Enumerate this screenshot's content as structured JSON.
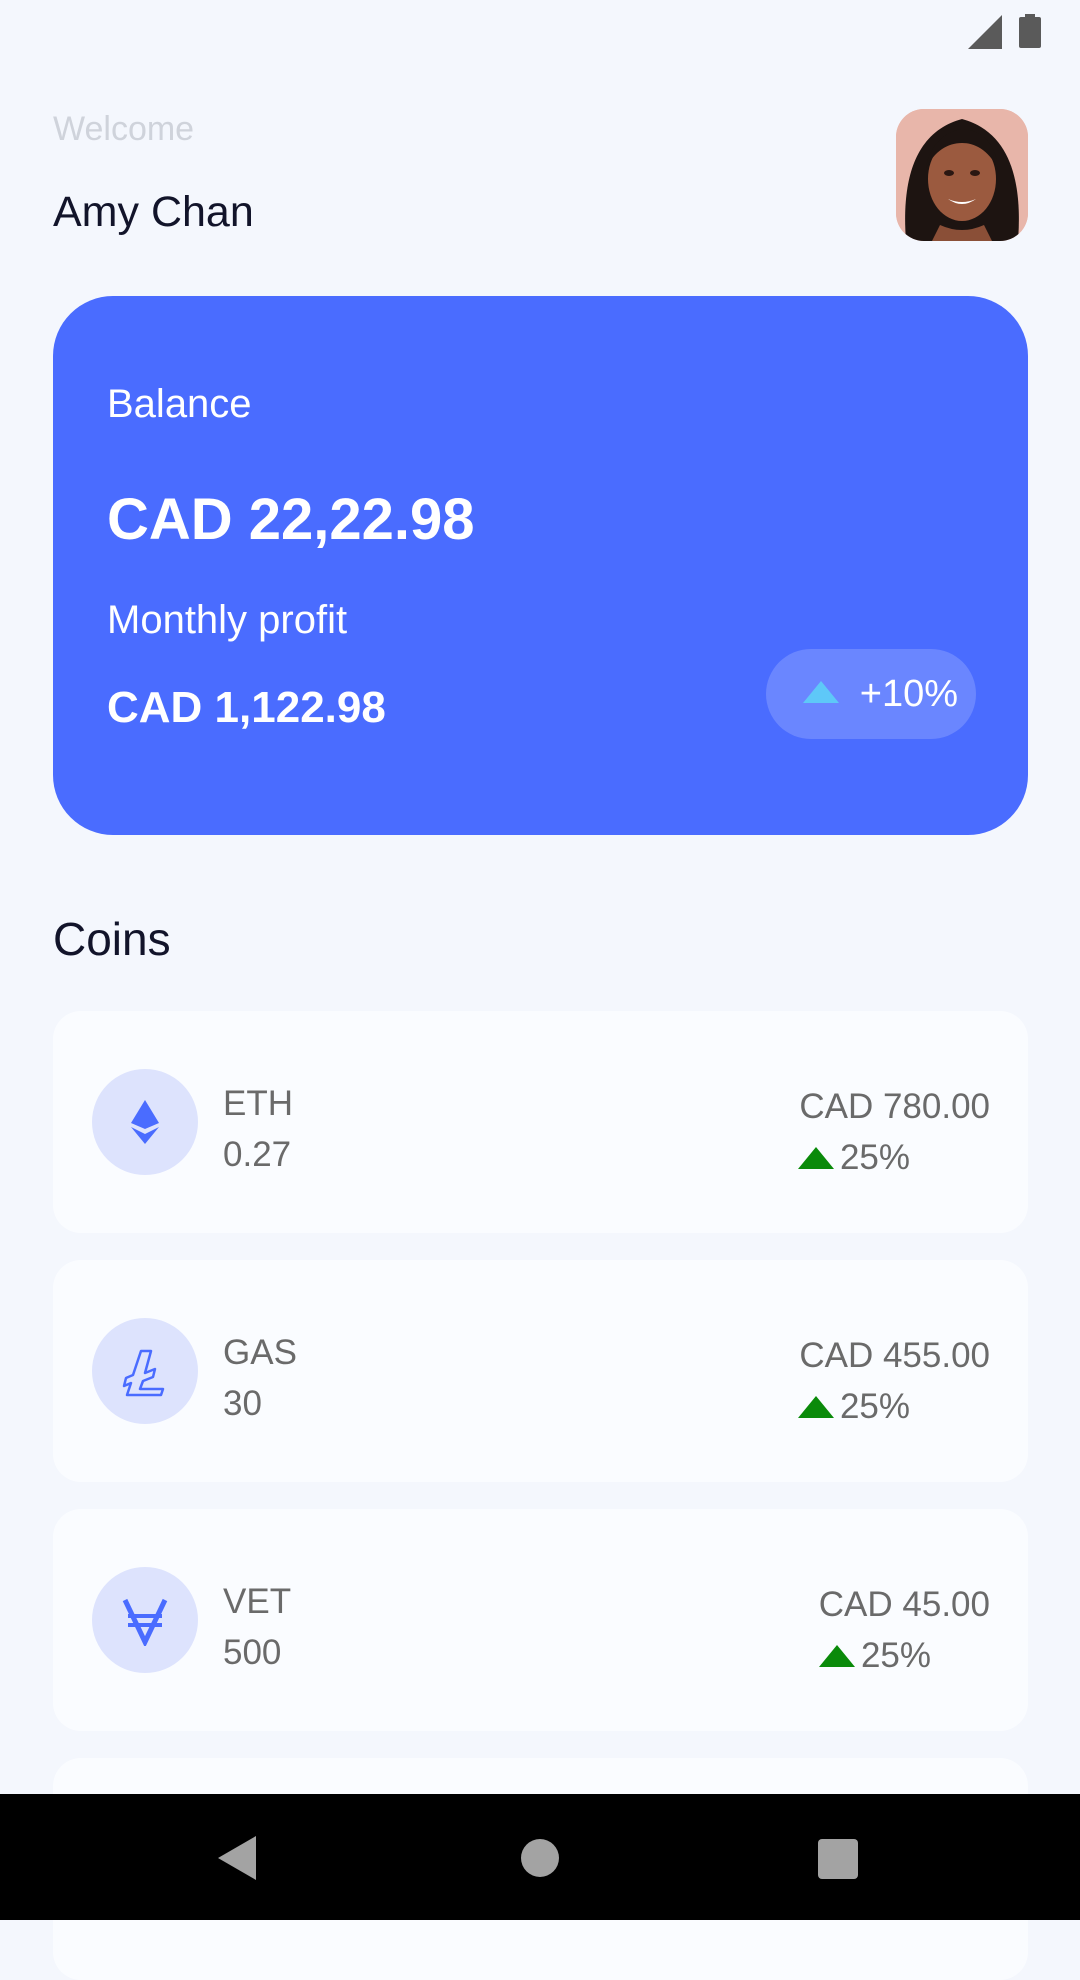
{
  "status_bar": {
    "icons": [
      "signal-icon",
      "battery-icon"
    ],
    "icon_color": "#5a5a5a"
  },
  "header": {
    "welcome": "Welcome",
    "user_name": "Amy Chan",
    "avatar_icon": "avatar-photo"
  },
  "balance_card": {
    "background_color": "#4a6cff",
    "balance_label": "Balance",
    "balance_amount": "CAD 22,22.98",
    "profit_label": "Monthly profit",
    "profit_amount": "CAD 1,122.98",
    "profit_change": "+10%",
    "profit_change_icon": "arrow-up-icon",
    "profit_change_color": "#5ec8f8"
  },
  "coins": {
    "title": "Coins",
    "positive_color": "#0a8a0a",
    "items": [
      {
        "icon": "ethereum-icon",
        "symbol": "ETH",
        "amount": "0.27",
        "value": "CAD 780.00",
        "change": "25%"
      },
      {
        "icon": "litecoin-icon",
        "symbol": "GAS",
        "amount": "30",
        "value": "CAD 455.00",
        "change": "25%"
      },
      {
        "icon": "vechain-icon",
        "symbol": "VET",
        "amount": "500",
        "value": "CAD 45.00",
        "change": "25%"
      }
    ]
  },
  "nav_bar": {
    "buttons": [
      "back-icon",
      "home-icon",
      "recents-icon"
    ]
  }
}
